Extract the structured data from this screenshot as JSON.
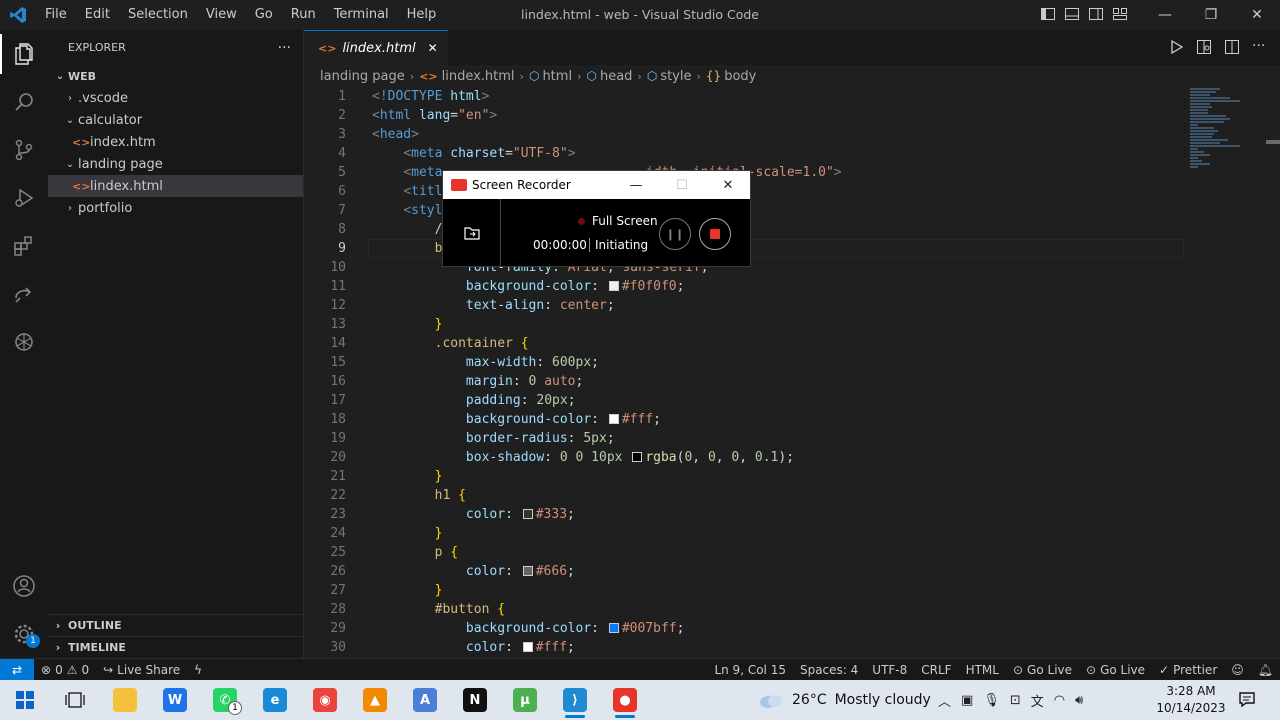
{
  "titlebar": {
    "menu": [
      "File",
      "Edit",
      "Selection",
      "View",
      "Go",
      "Run",
      "Terminal",
      "Help"
    ],
    "title": "lindex.html - web - Visual Studio Code"
  },
  "sidebar": {
    "header": "EXPLORER",
    "more": "···",
    "root": "WEB",
    "items": [
      {
        "label": ".vscode",
        "type": "folder",
        "open": false,
        "depth": 1
      },
      {
        "label": "calculator",
        "type": "folder",
        "open": true,
        "depth": 1
      },
      {
        "label": "index.htm",
        "type": "file",
        "depth": 2
      },
      {
        "label": "landing page",
        "type": "folder",
        "open": true,
        "depth": 1
      },
      {
        "label": "lindex.html",
        "type": "file",
        "depth": 2,
        "selected": true
      },
      {
        "label": "portfolio",
        "type": "folder",
        "open": false,
        "depth": 1
      }
    ],
    "outline": "OUTLINE",
    "timeline": "TIMELINE"
  },
  "tab": {
    "label": "lindex.html",
    "icon": "<>",
    "close": "✕"
  },
  "breadcrumb": [
    "landing page",
    "lindex.html",
    "html",
    "head",
    "style",
    "body"
  ],
  "editor": {
    "current_line": 9,
    "lines": [
      {
        "n": "1",
        "tokens": [
          [
            "t-br",
            "<!"
          ],
          [
            "t-tag",
            "DOCTYPE "
          ],
          [
            "t-attr",
            "html"
          ],
          [
            "t-br",
            ">"
          ]
        ]
      },
      {
        "n": "2",
        "tokens": [
          [
            "t-br",
            "<"
          ],
          [
            "t-tag",
            "html "
          ],
          [
            "t-attr",
            "lang"
          ],
          [
            "t-plain",
            "="
          ],
          [
            "t-str",
            "\"en\""
          ],
          [
            "t-br",
            ">"
          ]
        ]
      },
      {
        "n": "3",
        "tokens": [
          [
            "t-br",
            "<"
          ],
          [
            "t-tag",
            "head"
          ],
          [
            "t-br",
            ">"
          ]
        ]
      },
      {
        "n": "4",
        "tokens": [
          [
            "t-plain",
            "    "
          ],
          [
            "t-br",
            "<"
          ],
          [
            "t-tag",
            "meta "
          ],
          [
            "t-attr",
            "charset"
          ],
          [
            "t-plain",
            "="
          ],
          [
            "t-str",
            "\"UTF-8\""
          ],
          [
            "t-br",
            ">"
          ]
        ]
      },
      {
        "n": "5",
        "tokens": [
          [
            "t-plain",
            "    "
          ],
          [
            "t-br",
            "<"
          ],
          [
            "t-tag",
            "meta"
          ],
          [
            "t-plain",
            "                          "
          ],
          [
            "t-str",
            "idth, initial-scale=1.0\""
          ],
          [
            "t-br",
            ">"
          ]
        ]
      },
      {
        "n": "6",
        "tokens": [
          [
            "t-plain",
            "    "
          ],
          [
            "t-br",
            "<"
          ],
          [
            "t-tag",
            "titl"
          ]
        ]
      },
      {
        "n": "7",
        "tokens": [
          [
            "t-plain",
            "    "
          ],
          [
            "t-br",
            "<"
          ],
          [
            "t-tag",
            "styl"
          ]
        ]
      },
      {
        "n": "8",
        "tokens": [
          [
            "t-plain",
            "        "
          ],
          [
            "t-plain",
            "/"
          ]
        ]
      },
      {
        "n": "9",
        "tokens": [
          [
            "t-plain",
            "        "
          ],
          [
            "t-sel",
            "b"
          ]
        ]
      },
      {
        "n": "10",
        "tokens": [
          [
            "t-plain",
            "            "
          ],
          [
            "t-prop",
            "font-family"
          ],
          [
            "t-white",
            ": "
          ],
          [
            "t-val",
            "Arial"
          ],
          [
            "t-white",
            ", "
          ],
          [
            "t-val",
            "sans-serif"
          ],
          [
            "t-white",
            ";"
          ]
        ]
      },
      {
        "n": "11",
        "tokens": [
          [
            "t-plain",
            "            "
          ],
          [
            "t-prop",
            "background-color"
          ],
          [
            "t-white",
            ": "
          ],
          [
            "swatch",
            "#f0f0f0"
          ],
          [
            "t-val",
            "#f0f0f0"
          ],
          [
            "t-white",
            ";"
          ]
        ]
      },
      {
        "n": "12",
        "tokens": [
          [
            "t-plain",
            "            "
          ],
          [
            "t-prop",
            "text-align"
          ],
          [
            "t-white",
            ": "
          ],
          [
            "t-val",
            "center"
          ],
          [
            "t-white",
            ";"
          ]
        ]
      },
      {
        "n": "13",
        "tokens": [
          [
            "t-plain",
            "        "
          ],
          [
            "t-brace",
            "}"
          ]
        ]
      },
      {
        "n": "14",
        "tokens": [
          [
            "t-plain",
            "        "
          ],
          [
            "t-sel",
            ".container "
          ],
          [
            "t-brace",
            "{"
          ]
        ]
      },
      {
        "n": "15",
        "tokens": [
          [
            "t-plain",
            "            "
          ],
          [
            "t-prop",
            "max-width"
          ],
          [
            "t-white",
            ": "
          ],
          [
            "t-num",
            "600px"
          ],
          [
            "t-white",
            ";"
          ]
        ]
      },
      {
        "n": "16",
        "tokens": [
          [
            "t-plain",
            "            "
          ],
          [
            "t-prop",
            "margin"
          ],
          [
            "t-white",
            ": "
          ],
          [
            "t-num",
            "0 "
          ],
          [
            "t-val",
            "auto"
          ],
          [
            "t-white",
            ";"
          ]
        ]
      },
      {
        "n": "17",
        "tokens": [
          [
            "t-plain",
            "            "
          ],
          [
            "t-prop",
            "padding"
          ],
          [
            "t-white",
            ": "
          ],
          [
            "t-num",
            "20px"
          ],
          [
            "t-white",
            ";"
          ]
        ]
      },
      {
        "n": "18",
        "tokens": [
          [
            "t-plain",
            "            "
          ],
          [
            "t-prop",
            "background-color"
          ],
          [
            "t-white",
            ": "
          ],
          [
            "swatch",
            "#ffffff"
          ],
          [
            "t-val",
            "#fff"
          ],
          [
            "t-white",
            ";"
          ]
        ]
      },
      {
        "n": "19",
        "tokens": [
          [
            "t-plain",
            "            "
          ],
          [
            "t-prop",
            "border-radius"
          ],
          [
            "t-white",
            ": "
          ],
          [
            "t-num",
            "5px"
          ],
          [
            "t-white",
            ";"
          ]
        ]
      },
      {
        "n": "20",
        "tokens": [
          [
            "t-plain",
            "            "
          ],
          [
            "t-prop",
            "box-shadow"
          ],
          [
            "t-white",
            ": "
          ],
          [
            "t-num",
            "0 0 10px "
          ],
          [
            "swatch",
            "#000000"
          ],
          [
            "t-fn",
            "rgba"
          ],
          [
            "t-white",
            "("
          ],
          [
            "t-num",
            "0"
          ],
          [
            "t-white",
            ", "
          ],
          [
            "t-num",
            "0"
          ],
          [
            "t-white",
            ", "
          ],
          [
            "t-num",
            "0"
          ],
          [
            "t-white",
            ", "
          ],
          [
            "t-num",
            "0.1"
          ],
          [
            "t-white",
            ");"
          ]
        ]
      },
      {
        "n": "21",
        "tokens": [
          [
            "t-plain",
            "        "
          ],
          [
            "t-brace",
            "}"
          ]
        ]
      },
      {
        "n": "22",
        "tokens": [
          [
            "t-plain",
            "        "
          ],
          [
            "t-sel",
            "h1 "
          ],
          [
            "t-brace",
            "{"
          ]
        ]
      },
      {
        "n": "23",
        "tokens": [
          [
            "t-plain",
            "            "
          ],
          [
            "t-prop",
            "color"
          ],
          [
            "t-white",
            ": "
          ],
          [
            "swatch",
            "#333333"
          ],
          [
            "t-val",
            "#333"
          ],
          [
            "t-white",
            ";"
          ]
        ]
      },
      {
        "n": "24",
        "tokens": [
          [
            "t-plain",
            "        "
          ],
          [
            "t-brace",
            "}"
          ]
        ]
      },
      {
        "n": "25",
        "tokens": [
          [
            "t-plain",
            "        "
          ],
          [
            "t-sel",
            "p "
          ],
          [
            "t-brace",
            "{"
          ]
        ]
      },
      {
        "n": "26",
        "tokens": [
          [
            "t-plain",
            "            "
          ],
          [
            "t-prop",
            "color"
          ],
          [
            "t-white",
            ": "
          ],
          [
            "swatch",
            "#666666"
          ],
          [
            "t-val",
            "#666"
          ],
          [
            "t-white",
            ";"
          ]
        ]
      },
      {
        "n": "27",
        "tokens": [
          [
            "t-plain",
            "        "
          ],
          [
            "t-brace",
            "}"
          ]
        ]
      },
      {
        "n": "28",
        "tokens": [
          [
            "t-plain",
            "        "
          ],
          [
            "t-sel",
            "#button "
          ],
          [
            "t-brace",
            "{"
          ]
        ]
      },
      {
        "n": "29",
        "tokens": [
          [
            "t-plain",
            "            "
          ],
          [
            "t-prop",
            "background-color"
          ],
          [
            "t-white",
            ": "
          ],
          [
            "swatch",
            "#007bff"
          ],
          [
            "t-val",
            "#007bff"
          ],
          [
            "t-white",
            ";"
          ]
        ]
      },
      {
        "n": "30",
        "tokens": [
          [
            "t-plain",
            "            "
          ],
          [
            "t-prop",
            "color"
          ],
          [
            "t-white",
            ": "
          ],
          [
            "swatch",
            "#ffffff"
          ],
          [
            "t-val",
            "#fff"
          ],
          [
            "t-white",
            ";"
          ]
        ]
      }
    ]
  },
  "recorder": {
    "title": "Screen Recorder",
    "mode": "Full Screen",
    "time": "00:00:00",
    "state": "Initiating"
  },
  "statusbar": {
    "errors": "0",
    "warnings": "0",
    "live_share": "Live Share",
    "position": "Ln 9, Col 15",
    "spaces": "Spaces: 4",
    "encoding": "UTF-8",
    "eol": "CRLF",
    "language": "HTML",
    "go_live_1": "Go Live",
    "go_live_2": "Go Live",
    "prettier": "Prettier"
  },
  "taskbar": {
    "apps": [
      {
        "name": "start",
        "color": "#0078d4",
        "glyph": ""
      },
      {
        "name": "task-view",
        "color": "#333333",
        "glyph": ""
      },
      {
        "name": "file-explorer",
        "color": "#f3c13a",
        "glyph": ""
      },
      {
        "name": "wps",
        "color": "#1e73e8",
        "glyph": "W"
      },
      {
        "name": "whatsapp",
        "color": "#25d366",
        "glyph": "✆",
        "badge": "1"
      },
      {
        "name": "edge",
        "color": "#1a8ad8",
        "glyph": "e"
      },
      {
        "name": "chrome",
        "color": "#e8453c",
        "glyph": "◉"
      },
      {
        "name": "vlc",
        "color": "#f08a00",
        "glyph": "▲"
      },
      {
        "name": "font-app",
        "color": "#4a7fd6",
        "glyph": "A"
      },
      {
        "name": "netflix",
        "color": "#111111",
        "glyph": "N"
      },
      {
        "name": "utorrent",
        "color": "#4caf50",
        "glyph": "µ"
      },
      {
        "name": "vscode",
        "color": "#1f8ad2",
        "glyph": "⟩",
        "open": true
      },
      {
        "name": "screen-recorder",
        "color": "#e5352c",
        "glyph": "●",
        "open": true
      }
    ],
    "temperature": "26°C",
    "weather": "Mostly cloudy",
    "time": "3:28 AM",
    "date": "10/14/2023"
  }
}
